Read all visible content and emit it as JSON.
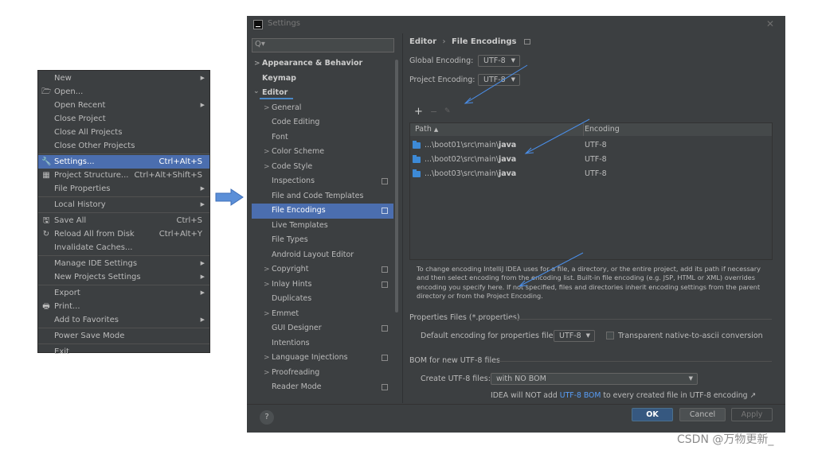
{
  "file_menu": {
    "items": [
      {
        "label": "New",
        "arrow": "▶"
      },
      {
        "label": "Open...",
        "icon": "🗁"
      },
      {
        "label": "Open Recent",
        "arrow": "▶"
      },
      {
        "label": "Close Project"
      },
      {
        "label": "Close All Projects"
      },
      {
        "label": "Close Other Projects"
      },
      {
        "label": "Settings...",
        "shortcut": "Ctrl+Alt+S",
        "icon": "🔧"
      },
      {
        "label": "Project Structure...",
        "shortcut": "Ctrl+Alt+Shift+S",
        "icon": "▦"
      },
      {
        "label": "File Properties",
        "arrow": "▶"
      },
      {
        "label": "Local History",
        "arrow": "▶"
      },
      {
        "label": "Save All",
        "shortcut": "Ctrl+S",
        "icon": "🖫"
      },
      {
        "label": "Reload All from Disk",
        "shortcut": "Ctrl+Alt+Y",
        "icon": "↻"
      },
      {
        "label": "Invalidate Caches..."
      },
      {
        "label": "Manage IDE Settings",
        "arrow": "▶"
      },
      {
        "label": "New Projects Settings",
        "arrow": "▶"
      },
      {
        "label": "Export",
        "arrow": "▶"
      },
      {
        "label": "Print...",
        "icon": "🖶"
      },
      {
        "label": "Add to Favorites",
        "arrow": "▶"
      },
      {
        "label": "Power Save Mode"
      },
      {
        "label": "Exit"
      }
    ]
  },
  "settings": {
    "title": "Settings",
    "close": "✕",
    "search_icon": "Q▾",
    "tree": [
      {
        "label": "Appearance & Behavior",
        "twisty": ">"
      },
      {
        "label": "Keymap"
      },
      {
        "label": "Editor",
        "twisty": "⌄"
      },
      {
        "label": "General",
        "twisty": ">"
      },
      {
        "label": "Code Editing"
      },
      {
        "label": "Font"
      },
      {
        "label": "Color Scheme",
        "twisty": ">"
      },
      {
        "label": "Code Style",
        "twisty": ">"
      },
      {
        "label": "Inspections"
      },
      {
        "label": "File and Code Templates"
      },
      {
        "label": "File Encodings"
      },
      {
        "label": "Live Templates"
      },
      {
        "label": "File Types"
      },
      {
        "label": "Android Layout Editor"
      },
      {
        "label": "Copyright",
        "twisty": ">"
      },
      {
        "label": "Inlay Hints",
        "twisty": ">"
      },
      {
        "label": "Duplicates"
      },
      {
        "label": "Emmet",
        "twisty": ">"
      },
      {
        "label": "GUI Designer"
      },
      {
        "label": "Intentions"
      },
      {
        "label": "Language Injections",
        "twisty": ">"
      },
      {
        "label": "Proofreading",
        "twisty": ">"
      },
      {
        "label": "Reader Mode"
      }
    ],
    "breadcrumb": {
      "parent": "Editor",
      "sep": "›",
      "current": "File Encodings"
    },
    "global_encoding": {
      "label": "Global Encoding:",
      "value": "UTF-8"
    },
    "project_encoding": {
      "label": "Project Encoding:",
      "value": "UTF-8"
    },
    "toolbar": {
      "add": "+",
      "remove": "−",
      "edit": "✎"
    },
    "table": {
      "headers": {
        "path": "Path",
        "sort": "▲",
        "encoding": "Encoding"
      },
      "rows": [
        {
          "path_prefix": "...\\boot01\\src\\main\\",
          "path_bold": "java",
          "encoding": "UTF-8"
        },
        {
          "path_prefix": "...\\boot02\\src\\main\\",
          "path_bold": "java",
          "encoding": "UTF-8"
        },
        {
          "path_prefix": "...\\boot03\\src\\main\\",
          "path_bold": "java",
          "encoding": "UTF-8"
        }
      ]
    },
    "info": "To change encoding IntelliJ IDEA uses for a file, a directory, or the entire project, add its path if necessary and then select encoding from the encoding list. Built-in file encoding (e.g. JSP, HTML or XML) overrides encoding you specify here. If not specified, files and directories inherit encoding settings from the parent directory or from the Project Encoding.",
    "properties": {
      "section": "Properties Files (*.properties)",
      "default_label": "Default encoding for properties files:",
      "default_value": "UTF-8",
      "transparent_label": "Transparent native-to-ascii conversion"
    },
    "bom": {
      "section": "BOM for new UTF-8 files",
      "create_label": "Create UTF-8 files:",
      "create_value": "with NO BOM",
      "note_pre": "IDEA will NOT add ",
      "note_link": "UTF-8 BOM",
      "note_post": " to every created file in UTF-8 encoding ↗"
    },
    "buttons": {
      "help": "?",
      "ok": "OK",
      "cancel": "Cancel",
      "apply": "Apply"
    },
    "combo_arrow": "▼"
  },
  "watermark": "CSDN @万物更新_",
  "colors": {
    "selection": "#4b6eaf",
    "arrow_fill": "#5b8fd8",
    "annotation_line": "#4a8ee8"
  }
}
